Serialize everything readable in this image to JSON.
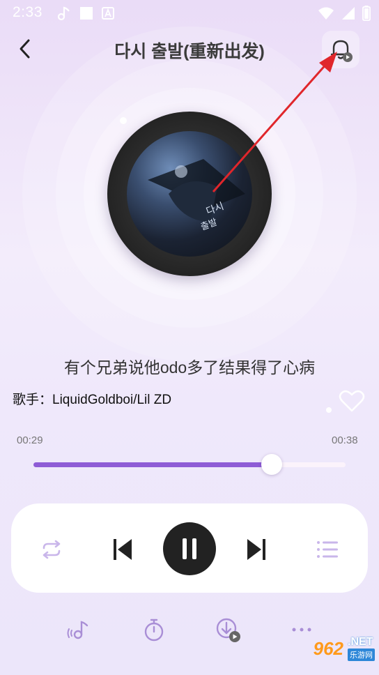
{
  "status_bar": {
    "time": "2:33",
    "left_icons": [
      "music-note-icon",
      "square-icon",
      "a-icon"
    ],
    "right_icons": [
      "wifi-icon",
      "signal-icon",
      "battery-icon"
    ]
  },
  "header": {
    "title": "다시 출발(重新出发)",
    "back_icon": "chevron-left-icon",
    "bell_icon": "bell-icon"
  },
  "player": {
    "lyric": "有个兄弟说他odo多了结果得了心病",
    "artist_label": "歌手：",
    "artist": "LiquidGoldboi/Lil ZD",
    "current_time": "00:29",
    "total_time": "00:38",
    "progress_fraction": 0.763
  },
  "controls": {
    "repeat_icon": "repeat-icon",
    "previous_icon": "skip-previous-icon",
    "play_pause_icon": "pause-icon",
    "next_icon": "skip-next-icon",
    "playlist_icon": "playlist-icon"
  },
  "toolbar": {
    "items": [
      "ringtone-icon",
      "timer-icon",
      "download-icon",
      "more-icon"
    ]
  },
  "watermark": {
    "number": "962",
    "net": ".NET",
    "sub": "乐游网"
  },
  "colors": {
    "accent": "#8e5cd6",
    "arrow": "#e0262b",
    "background_top": "#eadcf7"
  }
}
